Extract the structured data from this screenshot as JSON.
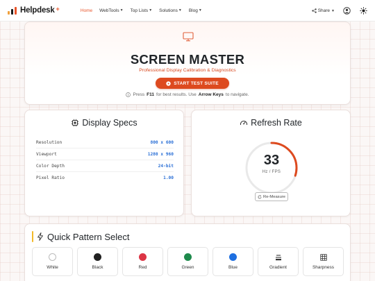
{
  "brand": {
    "name": "Helpdesk",
    "plus": "+"
  },
  "nav": [
    {
      "label": "Home",
      "active": true,
      "caret": false
    },
    {
      "label": "WebTools",
      "active": false,
      "caret": true
    },
    {
      "label": "Top Lists",
      "active": false,
      "caret": true
    },
    {
      "label": "Solutions",
      "active": false,
      "caret": true
    },
    {
      "label": "Blog",
      "active": false,
      "caret": true
    }
  ],
  "nav_right": {
    "share_label": "Share"
  },
  "hero": {
    "title": "SCREEN MASTER",
    "subtitle": "Professional Display Calibration & Diagnostics",
    "button_label": "START TEST SUITE",
    "hint_pre": "Press",
    "hint_key1": "F11",
    "hint_mid": "for best results. Use",
    "hint_key2": "Arrow Keys",
    "hint_post": "to navigate."
  },
  "display_specs": {
    "title": "Display Specs",
    "rows": [
      {
        "key": "Resolution",
        "value": "800 x 600"
      },
      {
        "key": "Viewport",
        "value": "1280 x 960"
      },
      {
        "key": "Color Depth",
        "value": "24-bit"
      },
      {
        "key": "Pixel Ratio",
        "value": "1.00"
      }
    ]
  },
  "refresh_rate": {
    "title": "Refresh Rate",
    "value": "33",
    "unit": "Hz / FPS",
    "gauge_fraction": 0.3,
    "button_label": "Re-Measure"
  },
  "patterns": {
    "title": "Quick Pattern Select",
    "items": [
      {
        "label": "White",
        "icon": "circle-icon",
        "color": "#ffffff"
      },
      {
        "label": "Black",
        "icon": "circle-icon",
        "color": "#212121"
      },
      {
        "label": "Red",
        "icon": "circle-icon",
        "color": "#dc3545"
      },
      {
        "label": "Green",
        "icon": "circle-icon",
        "color": "#1e8a4c"
      },
      {
        "label": "Blue",
        "icon": "circle-icon",
        "color": "#1e6fe0"
      },
      {
        "label": "Gradient",
        "icon": "gradient-icon"
      },
      {
        "label": "Sharpness",
        "icon": "grid-icon"
      }
    ]
  },
  "colors": {
    "accent": "#dd4a1f",
    "value_blue": "#2a6fd6",
    "highlight": "#f2b928"
  }
}
